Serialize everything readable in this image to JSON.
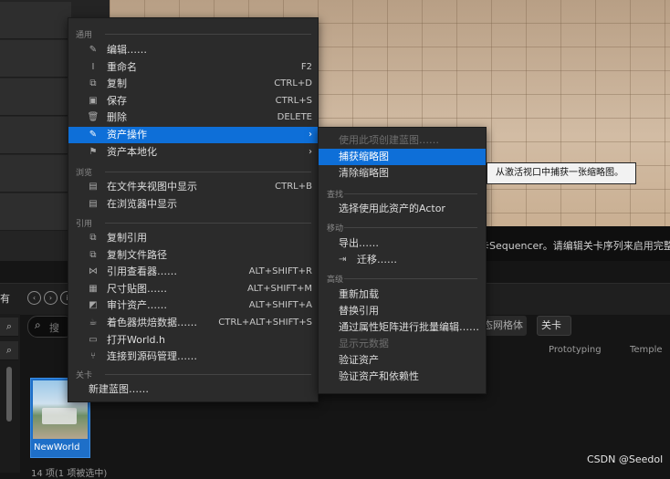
{
  "background": {
    "sequencer_hint": "卡Sequencer。请编辑关卡序列来启用完整",
    "all_label": "有",
    "search_placeholder": "搜",
    "filter_label": "态网格体",
    "level_chip": "关卡",
    "col_prototyping": "Prototyping",
    "col_temple": "Temple",
    "asset_name": "NewWorld",
    "status_line": "14 项(1 项被选中)"
  },
  "main_menu": {
    "section_common": "通用",
    "section_browse": "浏览",
    "section_reference": "引用",
    "section_level": "关卡",
    "items_common": [
      {
        "icon": "pencil-icon",
        "glyph": "✎",
        "label": "编辑……",
        "shortcut": ""
      },
      {
        "icon": "rename-icon",
        "glyph": "I",
        "label": "重命名",
        "shortcut": "F2"
      },
      {
        "icon": "copy-icon",
        "glyph": "⧉",
        "label": "复制",
        "shortcut": "CTRL+D"
      },
      {
        "icon": "save-icon",
        "glyph": "▣",
        "label": "保存",
        "shortcut": "CTRL+S"
      },
      {
        "icon": "trash-icon",
        "glyph": "🗑",
        "label": "删除",
        "shortcut": "DELETE"
      },
      {
        "icon": "wrench-icon",
        "glyph": "✎",
        "label": "资产操作",
        "shortcut": "",
        "submenu": true,
        "highlighted": true
      },
      {
        "icon": "flag-icon",
        "glyph": "⚑",
        "label": "资产本地化",
        "shortcut": "",
        "submenu": true
      }
    ],
    "items_browse": [
      {
        "icon": "folder-search-icon",
        "glyph": "▤",
        "label": "在文件夹视图中显示",
        "shortcut": "CTRL+B"
      },
      {
        "icon": "browser-icon",
        "glyph": "▤",
        "label": "在浏览器中显示",
        "shortcut": ""
      }
    ],
    "items_reference": [
      {
        "icon": "copy-reference-icon",
        "glyph": "⧉",
        "label": "复制引用",
        "shortcut": ""
      },
      {
        "icon": "copy-path-icon",
        "glyph": "⧉",
        "label": "复制文件路径",
        "shortcut": ""
      },
      {
        "icon": "reference-viewer-icon",
        "glyph": "⋈",
        "label": "引用查看器……",
        "shortcut": "ALT+SHIFT+R"
      },
      {
        "icon": "size-map-icon",
        "glyph": "▦",
        "label": "尺寸贴图……",
        "shortcut": "ALT+SHIFT+M"
      },
      {
        "icon": "audit-icon",
        "glyph": "◩",
        "label": "审计资产……",
        "shortcut": "ALT+SHIFT+A"
      },
      {
        "icon": "shader-cook-icon",
        "glyph": "☕",
        "label": "着色器烘焙数据……",
        "shortcut": "CTRL+ALT+SHIFT+S"
      },
      {
        "icon": "open-file-icon",
        "glyph": "▭",
        "label": "打开World.h",
        "shortcut": ""
      },
      {
        "icon": "source-control-icon",
        "glyph": "⑂",
        "label": "连接到源码管理……",
        "shortcut": ""
      }
    ],
    "items_level": [
      {
        "icon": "",
        "glyph": "",
        "label": "新建蓝图……",
        "shortcut": ""
      }
    ]
  },
  "sub_menu": {
    "create_blueprint": "使用此项创建蓝图……",
    "capture_thumbnail": "捕获缩略图",
    "clear_thumbnail": "清除缩略图",
    "section_find": "查找",
    "select_actors": "选择使用此资产的Actor",
    "section_move": "移动",
    "export": "导出……",
    "migrate": "迁移……",
    "section_advanced": "高级",
    "reload": "重新加载",
    "replace_references": "替换引用",
    "bulk_edit": "通过属性矩阵进行批量编辑……",
    "show_metadata": "显示元数据",
    "validate": "验证资产",
    "validate_deps": "验证资产和依赖性"
  },
  "tooltip": "从激活视口中捕获一张缩略图。",
  "watermark": "CSDN @Seedol",
  "colors": {
    "highlight": "#0e6fd8",
    "menu_bg": "#2b2b2b",
    "tooltip_bg": "#f2f2f2"
  }
}
